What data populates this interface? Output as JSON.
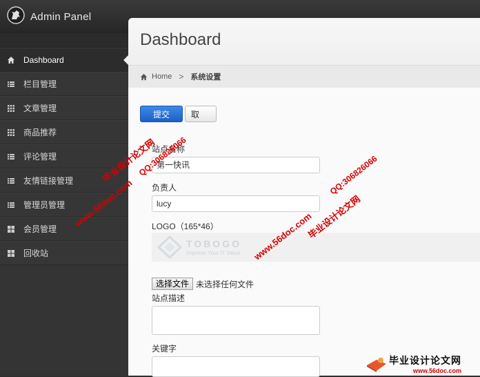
{
  "app": {
    "title": "Admin Panel"
  },
  "sidebar": {
    "items": [
      {
        "label": "Dashboard",
        "icon": "home-icon",
        "active": true
      },
      {
        "label": "栏目管理",
        "icon": "list-icon"
      },
      {
        "label": "文章管理",
        "icon": "grid-icon"
      },
      {
        "label": "商品推荐",
        "icon": "grid-icon"
      },
      {
        "label": "评论管理",
        "icon": "list-icon"
      },
      {
        "label": "友情链接管理",
        "icon": "list-icon"
      },
      {
        "label": "管理员管理",
        "icon": "list-icon"
      },
      {
        "label": "会员管理",
        "icon": "tiles-icon"
      },
      {
        "label": "回收站",
        "icon": "tiles-icon"
      }
    ]
  },
  "header": {
    "title": "Dashboard"
  },
  "breadcrumb": {
    "home": "Home",
    "separator": ">",
    "current": "系统设置"
  },
  "form": {
    "submit_label": "提交",
    "cancel_label": "取",
    "site_name_label": "站点名称",
    "site_name_value": "第一快讯",
    "owner_label": "负责人",
    "owner_value": "lucy",
    "logo_label": "LOGO（165*46）",
    "logo_name": "TOBOGO",
    "logo_tagline": "Improve Your IT Value",
    "file_button": "选择文件",
    "file_status": "未选择任何文件",
    "description_label": "站点描述",
    "keywords_label": "关键字"
  },
  "watermark": {
    "cn": "毕业设计论文网",
    "qq": "QQ:306826066",
    "url": "www.56doc.com",
    "footer_cn": "毕业设计论文网",
    "footer_url": "www.56doc.com"
  },
  "colors": {
    "primary": "#1b5fc7",
    "watermark": "#d40000",
    "sidebar": "#343434"
  }
}
